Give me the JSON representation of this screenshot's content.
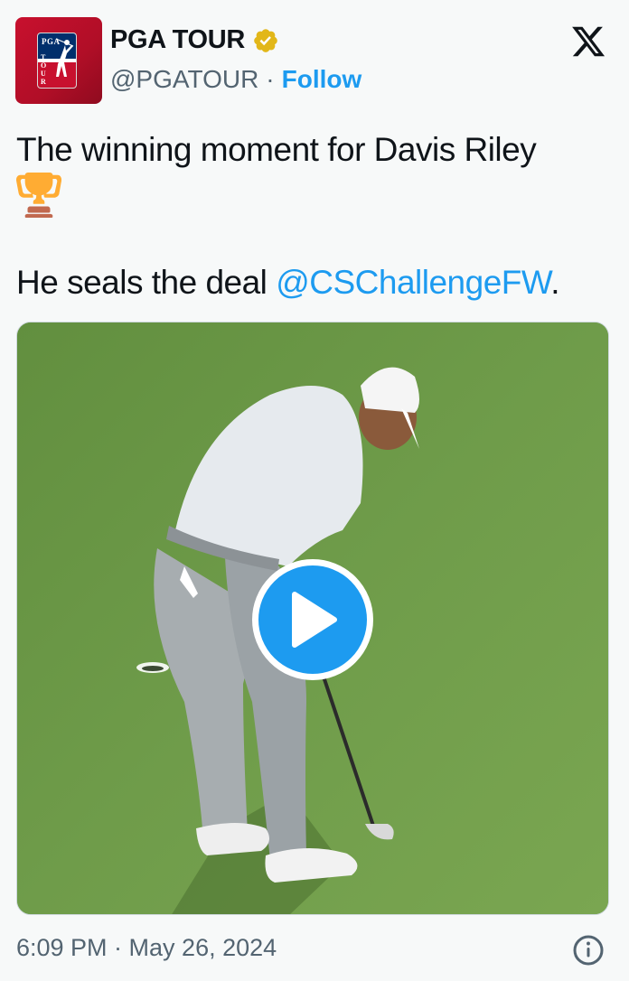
{
  "author": {
    "display_name": "PGA TOUR",
    "handle": "@PGATOUR",
    "separator": "·",
    "follow_label": "Follow",
    "avatar_icon": "pga-tour-logo-icon",
    "verified_icon": "verified-badge-icon",
    "verified_color": "#e2b719"
  },
  "platform_icon": "x-logo-icon",
  "tweet": {
    "line1": "The winning moment for Davis Riley",
    "emoji": "trophy-icon",
    "line2_prefix": "He seals the deal ",
    "mention": "@CSChallengeFW",
    "line2_suffix": "."
  },
  "media": {
    "type": "video",
    "play_icon": "play-icon"
  },
  "footer": {
    "timestamp": "6:09 PM · May 26, 2024",
    "info_icon": "info-icon"
  },
  "colors": {
    "accent": "#1d9bf0",
    "text": "#0f1419",
    "secondary": "#536471",
    "brand_red": "#c8102e"
  }
}
